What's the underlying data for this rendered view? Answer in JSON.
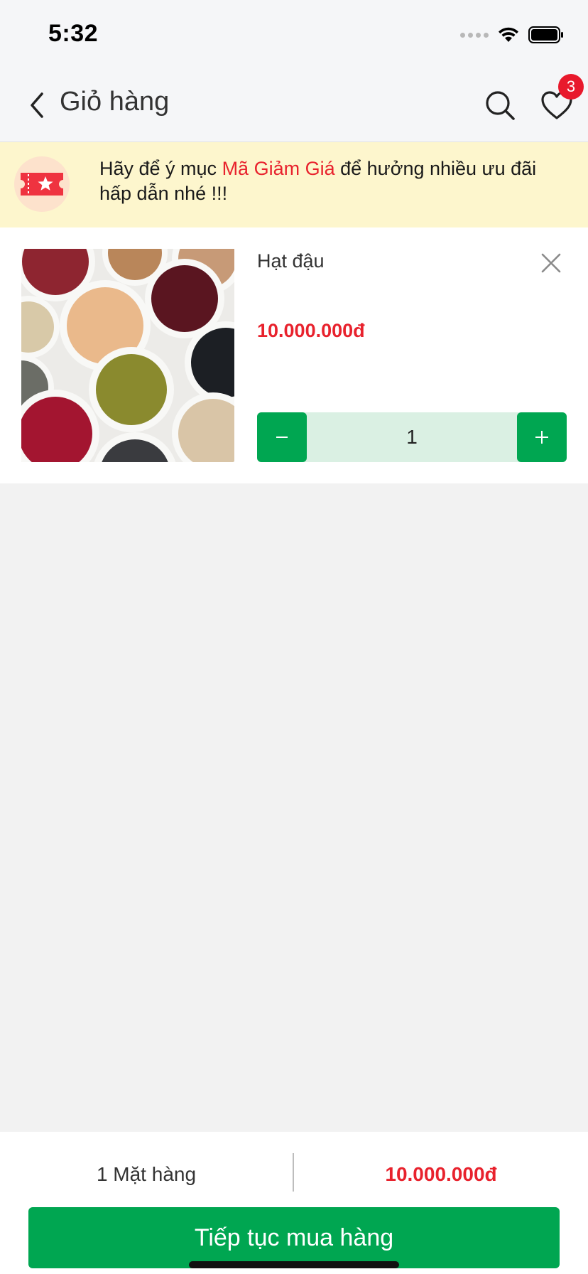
{
  "status_bar": {
    "time": "5:32"
  },
  "header": {
    "title": "Giỏ hàng",
    "wishlist_badge": "3"
  },
  "promo": {
    "text_before": "Hãy để ý mục ",
    "highlight": "Mã Giảm Giá",
    "text_after": " để hưởng nhiều ưu đãi hấp dẫn nhé !!!"
  },
  "cart": {
    "items": [
      {
        "name": "Hạt đậu",
        "price": "10.000.000đ",
        "quantity": "1"
      }
    ]
  },
  "summary": {
    "item_count": "1 Mặt hàng",
    "total": "10.000.000đ",
    "checkout_label": "Tiếp tục mua hàng"
  },
  "colors": {
    "accent_green": "#00a651",
    "price_red": "#e8222d",
    "promo_bg": "#fdf6cd",
    "qty_bg": "#daf0e3"
  }
}
